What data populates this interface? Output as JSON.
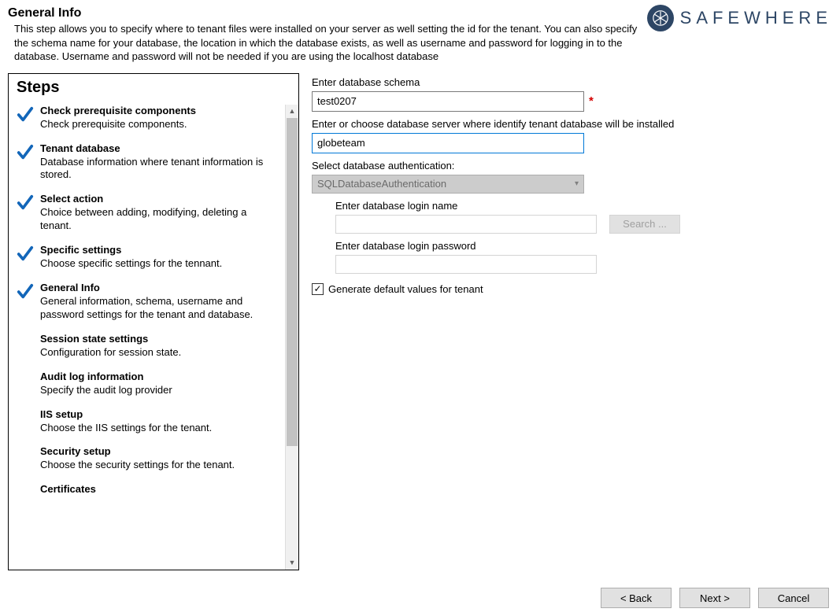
{
  "header": {
    "title": "General Info",
    "description": "This step allows you to specify where to tenant files were installed on your server as well setting the id for the tenant. You can also specify the schema name for your database, the location in which the database exists, as well as username and password for logging in to the database. Username and password will not be needed if you are using the localhost database"
  },
  "brand": {
    "name": "SAFEWHERE"
  },
  "stepsTitle": "Steps",
  "steps": [
    {
      "title": "Check prerequisite components",
      "desc": "Check prerequisite components.",
      "done": true
    },
    {
      "title": "Tenant database",
      "desc": "Database information where tenant information is stored.",
      "done": true
    },
    {
      "title": "Select action",
      "desc": "Choice between adding, modifying, deleting a tenant.",
      "done": true
    },
    {
      "title": "Specific settings",
      "desc": "Choose specific settings for the tennant.",
      "done": true
    },
    {
      "title": "General Info",
      "desc": "General information, schema, username and password settings for the tenant and database.",
      "done": true
    },
    {
      "title": "Session state settings",
      "desc": "Configuration for session state.",
      "done": false
    },
    {
      "title": "Audit log information",
      "desc": "Specify the audit log provider",
      "done": false
    },
    {
      "title": "IIS setup",
      "desc": "Choose the IIS settings for the tenant.",
      "done": false
    },
    {
      "title": "Security setup",
      "desc": "Choose the security settings for the tenant.",
      "done": false
    },
    {
      "title": "Certificates",
      "desc": "",
      "done": false
    }
  ],
  "form": {
    "schemaLabel": "Enter database schema",
    "schemaValue": "test0207",
    "serverLabel": "Enter or choose database server where identify tenant database will be installed",
    "serverValue": "globeteam",
    "authLabel": "Select database authentication:",
    "authValue": "SQLDatabaseAuthentication",
    "loginNameLabel": "Enter database login name",
    "loginNameValue": "",
    "loginPassLabel": "Enter database login password",
    "loginPassValue": "",
    "searchLabel": "Search ...",
    "genDefaultLabel": "Generate default values for tenant",
    "genDefaultChecked": true
  },
  "footer": {
    "back": "< Back",
    "next": "Next >",
    "cancel": "Cancel"
  }
}
